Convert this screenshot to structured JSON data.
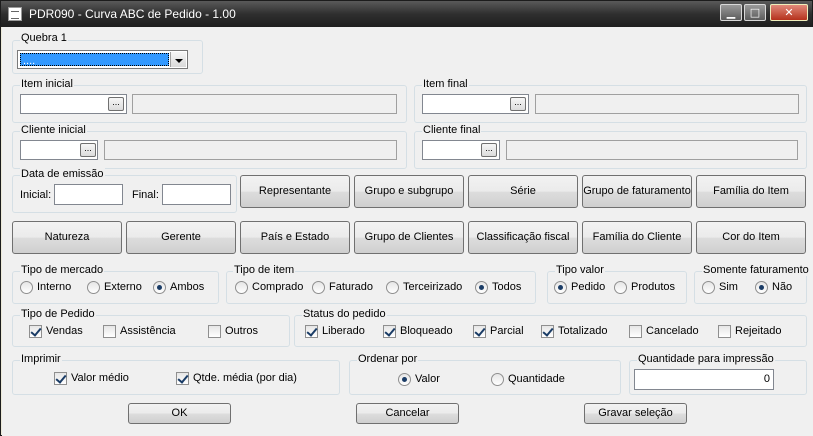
{
  "window": {
    "title": "PDR090 - Curva ABC de Pedido - 1.00"
  },
  "quebra": {
    "label": "Quebra 1",
    "value": "...."
  },
  "item_inicial": {
    "label": "Item inicial",
    "ellipsis": "..."
  },
  "item_final": {
    "label": "Item final",
    "ellipsis": "..."
  },
  "cliente_inicial": {
    "label": "Cliente inicial",
    "ellipsis": "..."
  },
  "cliente_final": {
    "label": "Cliente final",
    "ellipsis": "..."
  },
  "data_emissao": {
    "label": "Data de emissão",
    "inicial_label": "Inicial:",
    "final_label": "Final:"
  },
  "filter_buttons": [
    "Representante",
    "Grupo e subgrupo",
    "Série",
    "Grupo de faturamento",
    "Família do Item",
    "Natureza",
    "Gerente",
    "País e Estado",
    "Grupo de Clientes",
    "Classificação fiscal",
    "Família do Cliente",
    "Cor do Item"
  ],
  "tipo_mercado": {
    "label": "Tipo de mercado",
    "options": [
      "Interno",
      "Externo",
      "Ambos"
    ],
    "selected": "Ambos"
  },
  "tipo_item": {
    "label": "Tipo de item",
    "options": [
      "Comprado",
      "Faturado",
      "Terceirizado",
      "Todos"
    ],
    "selected": "Todos"
  },
  "tipo_valor": {
    "label": "Tipo valor",
    "options": [
      "Pedido",
      "Produtos"
    ],
    "selected": "Pedido"
  },
  "somente_faturamento": {
    "label": "Somente faturamento",
    "options": [
      "Sim",
      "Não"
    ],
    "selected": "Não"
  },
  "tipo_pedido": {
    "label": "Tipo de Pedido",
    "options": [
      {
        "label": "Vendas",
        "checked": true
      },
      {
        "label": "Assistência",
        "checked": false
      },
      {
        "label": "Outros",
        "checked": false
      }
    ]
  },
  "status_pedido": {
    "label": "Status do pedido",
    "options": [
      {
        "label": "Liberado",
        "checked": true
      },
      {
        "label": "Bloqueado",
        "checked": true
      },
      {
        "label": "Parcial",
        "checked": true
      },
      {
        "label": "Totalizado",
        "checked": true
      },
      {
        "label": "Cancelado",
        "checked": false
      },
      {
        "label": "Rejeitado",
        "checked": false
      }
    ]
  },
  "imprimir": {
    "label": "Imprimir",
    "options": [
      {
        "label": "Valor médio",
        "checked": true
      },
      {
        "label": "Qtde. média (por dia)",
        "checked": true
      }
    ]
  },
  "ordenar_por": {
    "label": "Ordenar por",
    "options": [
      "Valor",
      "Quantidade"
    ],
    "selected": "Valor"
  },
  "quantidade": {
    "label": "Quantidade para impressão",
    "value": "0"
  },
  "actions": {
    "ok": "OK",
    "cancel": "Cancelar",
    "save": "Gravar seleção"
  }
}
